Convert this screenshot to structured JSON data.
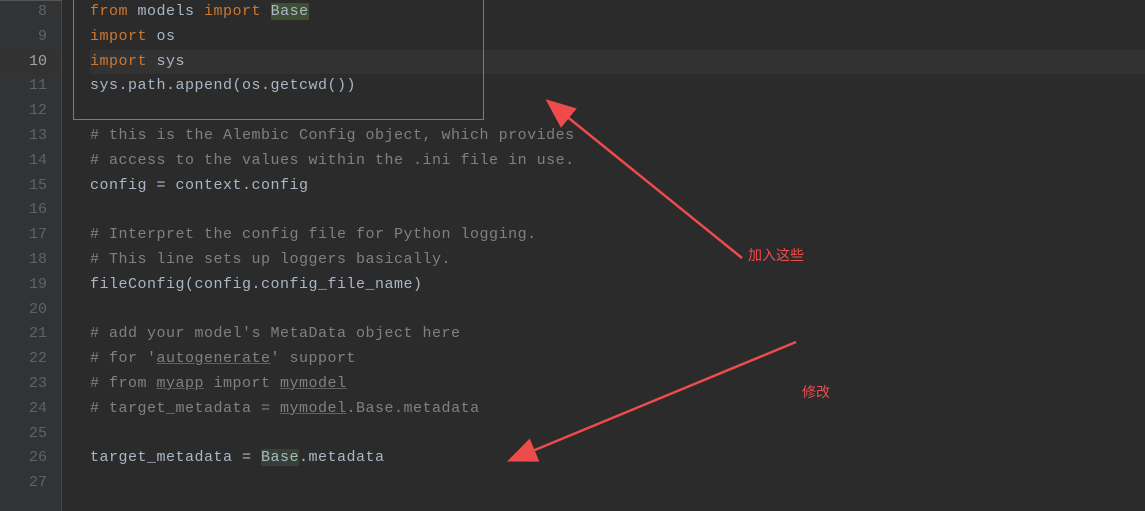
{
  "lines": {
    "start": 8,
    "end": 27,
    "current": 10
  },
  "code": {
    "l8": {
      "kw1": "from",
      "id1": " models ",
      "kw2": "import",
      "sp": " ",
      "base": "Base"
    },
    "l9": {
      "kw": "import",
      "id": " os"
    },
    "l10": {
      "kw": "import",
      "id": " sys"
    },
    "l11": {
      "t": "sys.path.append(os.getcwd())"
    },
    "l12": {
      "t": ""
    },
    "l13": {
      "t": "# this is the Alembic Config object, which provides"
    },
    "l14": {
      "t": "# access to the values within the .ini file in use."
    },
    "l15": {
      "t1": "config = context.",
      "t2": "config"
    },
    "l16": {
      "t": ""
    },
    "l17": {
      "t": "# Interpret the config file for Python logging."
    },
    "l18": {
      "t": "# This line sets up loggers basically."
    },
    "l19": {
      "t": "fileConfig(config.config_file_name)"
    },
    "l20": {
      "t": ""
    },
    "l21": {
      "t": "# add your model's MetaData object here"
    },
    "l22": {
      "t1": "# for '",
      "u": "autogenerate",
      "t2": "' support"
    },
    "l23": {
      "t1": "# from ",
      "u1": "myapp",
      "t2": " import ",
      "u2": "mymodel"
    },
    "l24": {
      "t1": "# target_metadata = ",
      "u": "mymodel",
      "t2": ".Base.metadata"
    },
    "l25": {
      "t": ""
    },
    "l26": {
      "t1": "target_metadata = ",
      "b": "Base",
      "t2": ".metadata"
    },
    "l27": {
      "t": ""
    }
  },
  "annotations": {
    "label1": "加入这些",
    "label2": "修改"
  }
}
